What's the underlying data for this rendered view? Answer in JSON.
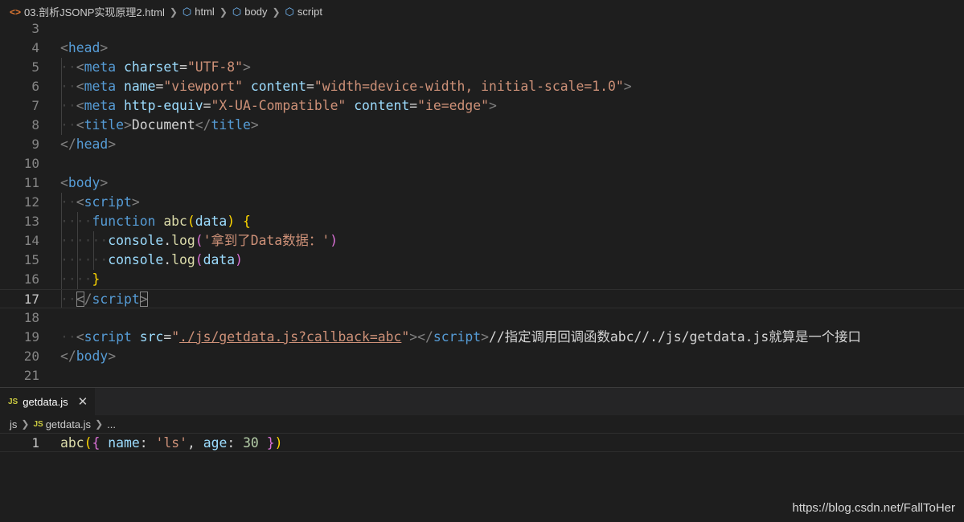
{
  "top_breadcrumb": {
    "file": "03.剖析JSONP实现原理2.html",
    "html": "html",
    "body": "body",
    "script": "script"
  },
  "editor1": {
    "line_numbers": [
      "3",
      "4",
      "5",
      "6",
      "7",
      "8",
      "9",
      "10",
      "11",
      "12",
      "13",
      "14",
      "15",
      "16",
      "17",
      "18",
      "19",
      "20",
      "21"
    ],
    "active_line": "17"
  },
  "bottom_tab": {
    "label": "getdata.js",
    "icon_text": "JS",
    "close": "✕"
  },
  "bottom_breadcrumb": {
    "folder": "js",
    "file": "getdata.js",
    "more": "..."
  },
  "editor2": {
    "line_numbers": [
      "1"
    ]
  },
  "watermark": "https://blog.csdn.net/FallToHer",
  "colors": {
    "background": "#1e1e1e",
    "tag": "#569cd6",
    "attribute": "#9cdcfe",
    "string": "#ce9178",
    "function": "#dcdcaa",
    "number": "#b5cea8"
  }
}
